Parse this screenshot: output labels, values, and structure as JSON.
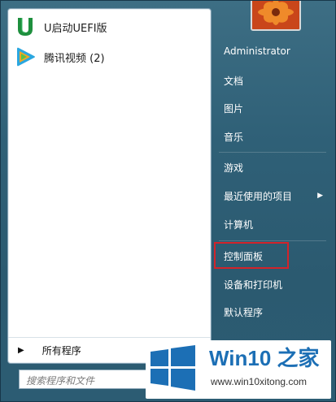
{
  "left_pane": {
    "pinned": [
      {
        "label": "U启动UEFI版",
        "icon": "uqidong-u-icon"
      },
      {
        "label": "腾讯视频 (2)",
        "icon": "tencent-video-icon"
      }
    ],
    "all_programs_label": "所有程序"
  },
  "search": {
    "placeholder": "搜索程序和文件"
  },
  "right_pane": {
    "items": [
      {
        "label": "Administrator"
      },
      {
        "label": "文档"
      },
      {
        "label": "图片"
      },
      {
        "label": "音乐"
      },
      {
        "label": "游戏"
      },
      {
        "label": "最近使用的项目",
        "has_submenu": true
      },
      {
        "label": "计算机"
      },
      {
        "label": "控制面板",
        "highlighted": true
      },
      {
        "label": "设备和打印机"
      },
      {
        "label": "默认程序"
      }
    ]
  },
  "watermark": {
    "title": "Win10 之家",
    "url": "www.win10xitong.com",
    "brand_color": "#1c6fb5"
  },
  "colors": {
    "highlight_border": "#d3232a",
    "menu_background": "#2f6077"
  }
}
